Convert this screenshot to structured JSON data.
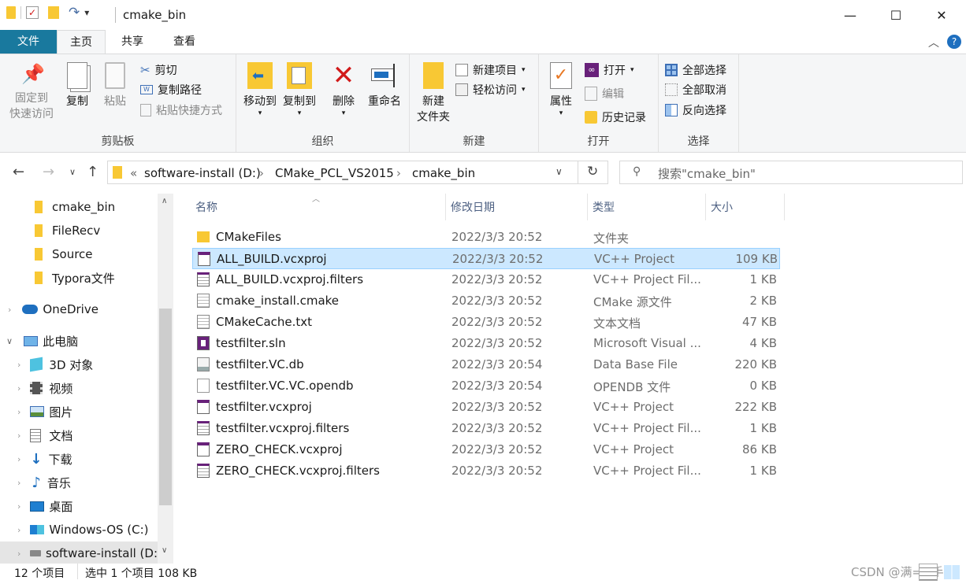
{
  "window": {
    "title": "cmake_bin",
    "controls": {
      "minimize": "—",
      "maximize": "☐",
      "close": "✕"
    }
  },
  "qat_dropdown": "▾",
  "ribbon_tabs": [
    "文件",
    "主页",
    "共享",
    "查看"
  ],
  "ribbon": {
    "clipboard": {
      "label": "剪贴板",
      "pin": "固定到\n快速访问",
      "pin_l1": "固定到",
      "pin_l2": "快速访问",
      "copy": "复制",
      "paste": "粘贴",
      "cut": "剪切",
      "copy_path": "复制路径",
      "paste_shortcut": "粘贴快捷方式"
    },
    "organize": {
      "label": "组织",
      "move_to": "移动到",
      "copy_to": "复制到",
      "delete": "删除",
      "rename": "重命名"
    },
    "new": {
      "label": "新建",
      "new_folder_l1": "新建",
      "new_folder_l2": "文件夹",
      "new_item": "新建项目",
      "easy_access": "轻松访问"
    },
    "open": {
      "label": "打开",
      "properties": "属性",
      "open": "打开",
      "edit": "编辑",
      "history": "历史记录"
    },
    "select": {
      "label": "选择",
      "select_all": "全部选择",
      "select_none": "全部取消",
      "invert": "反向选择"
    }
  },
  "address": {
    "crumbs": [
      "«",
      "software-install (D:)",
      "CMake_PCL_VS2015",
      "cmake_bin"
    ],
    "search_placeholder": "搜索\"cmake_bin\""
  },
  "nav": [
    {
      "label": "cmake_bin",
      "kind": "folder"
    },
    {
      "label": "FileRecv",
      "kind": "folder"
    },
    {
      "label": "Source",
      "kind": "folder"
    },
    {
      "label": "Typora文件",
      "kind": "folder"
    },
    {
      "label": "OneDrive",
      "kind": "onedrive"
    },
    {
      "label": "此电脑",
      "kind": "pc"
    },
    {
      "label": "3D 对象",
      "kind": "3d"
    },
    {
      "label": "视频",
      "kind": "video"
    },
    {
      "label": "图片",
      "kind": "pictures"
    },
    {
      "label": "文档",
      "kind": "docs"
    },
    {
      "label": "下载",
      "kind": "download"
    },
    {
      "label": "音乐",
      "kind": "music"
    },
    {
      "label": "桌面",
      "kind": "desktop"
    },
    {
      "label": "Windows-OS (C:)",
      "kind": "drive"
    },
    {
      "label": "software-install (D:",
      "kind": "drive"
    }
  ],
  "columns": {
    "name": "名称",
    "date": "修改日期",
    "type": "类型",
    "size": "大小"
  },
  "files": [
    {
      "name": "CMakeFiles",
      "date": "2022/3/3 20:52",
      "type": "文件夹",
      "size": "",
      "icon": "folder"
    },
    {
      "name": "ALL_BUILD.vcxproj",
      "date": "2022/3/3 20:52",
      "type": "VC++ Project",
      "size": "109 KB",
      "icon": "vcxproj"
    },
    {
      "name": "ALL_BUILD.vcxproj.filters",
      "date": "2022/3/3 20:52",
      "type": "VC++ Project Fil...",
      "size": "1 KB",
      "icon": "filters"
    },
    {
      "name": "cmake_install.cmake",
      "date": "2022/3/3 20:52",
      "type": "CMake 源文件",
      "size": "2 KB",
      "icon": "text"
    },
    {
      "name": "CMakeCache.txt",
      "date": "2022/3/3 20:52",
      "type": "文本文档",
      "size": "47 KB",
      "icon": "text"
    },
    {
      "name": "testfilter.sln",
      "date": "2022/3/3 20:52",
      "type": "Microsoft Visual ...",
      "size": "4 KB",
      "icon": "sln"
    },
    {
      "name": "testfilter.VC.db",
      "date": "2022/3/3 20:54",
      "type": "Data Base File",
      "size": "220 KB",
      "icon": "db"
    },
    {
      "name": "testfilter.VC.VC.opendb",
      "date": "2022/3/3 20:54",
      "type": "OPENDB 文件",
      "size": "0 KB",
      "icon": "blank"
    },
    {
      "name": "testfilter.vcxproj",
      "date": "2022/3/3 20:52",
      "type": "VC++ Project",
      "size": "222 KB",
      "icon": "vcxproj"
    },
    {
      "name": "testfilter.vcxproj.filters",
      "date": "2022/3/3 20:52",
      "type": "VC++ Project Fil...",
      "size": "1 KB",
      "icon": "filters"
    },
    {
      "name": "ZERO_CHECK.vcxproj",
      "date": "2022/3/3 20:52",
      "type": "VC++ Project",
      "size": "86 KB",
      "icon": "vcxproj"
    },
    {
      "name": "ZERO_CHECK.vcxproj.filters",
      "date": "2022/3/3 20:52",
      "type": "VC++ Project Fil...",
      "size": "1 KB",
      "icon": "filters"
    }
  ],
  "selected_index": 1,
  "status": {
    "count": "12 个项目",
    "selection": "选中 1 个项目 108 KB"
  },
  "watermark": "CSDN @满==手",
  "colors": {
    "file_tab": "#19799e",
    "selection": "#cce8ff",
    "folder": "#f8c834",
    "delete_red": "#d11a1a"
  }
}
